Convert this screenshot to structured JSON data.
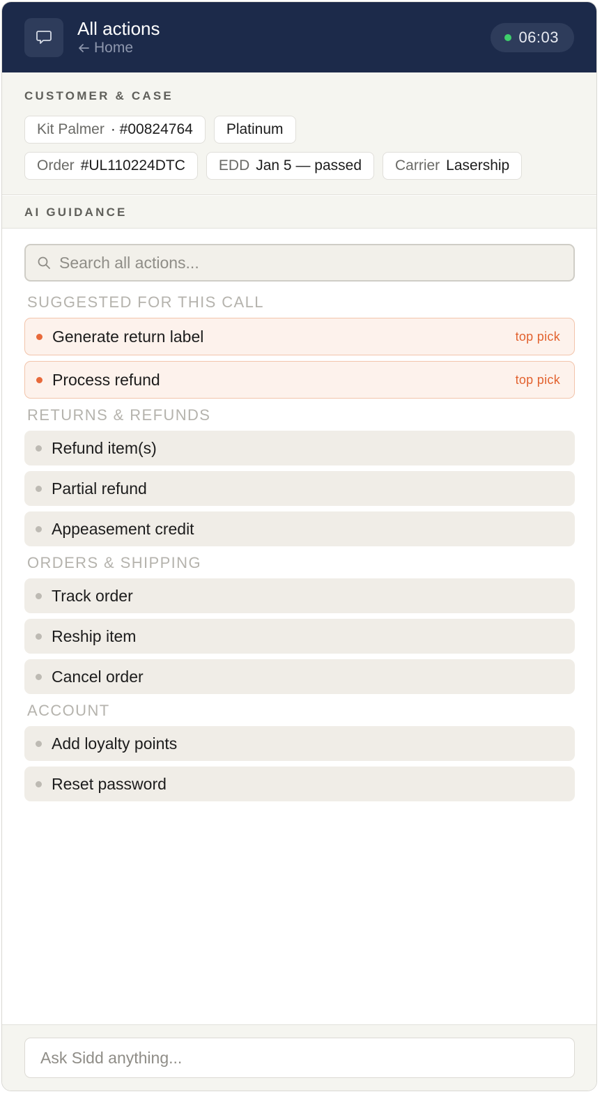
{
  "header": {
    "title": "All actions",
    "back_label": "Home",
    "timer": "06:03",
    "timer_status_color": "#3ecf6b",
    "icon": "chat-bubble-icon"
  },
  "case": {
    "section_label": "CUSTOMER & CASE",
    "customer_name": "Kit Palmer",
    "customer_id": "· #00824764",
    "tier": "Platinum",
    "order_label": "Order",
    "order_value": "#UL110224DTC",
    "edd_label": "EDD",
    "edd_value": "Jan 5 — passed",
    "carrier_label": "Carrier",
    "carrier_value": "Lasership"
  },
  "guidance": {
    "section_label": "AI GUIDANCE"
  },
  "search": {
    "placeholder": "Search all actions..."
  },
  "groups": {
    "suggested": {
      "title": "SUGGESTED FOR THIS CALL",
      "items": [
        {
          "label": "Generate return label",
          "badge": "top pick"
        },
        {
          "label": "Process refund",
          "badge": "top pick"
        }
      ]
    },
    "returns": {
      "title": "RETURNS & REFUNDS",
      "items": [
        {
          "label": "Refund item(s)"
        },
        {
          "label": "Partial refund"
        },
        {
          "label": "Appeasement credit"
        }
      ]
    },
    "orders": {
      "title": "ORDERS & SHIPPING",
      "items": [
        {
          "label": "Track order"
        },
        {
          "label": "Reship item"
        },
        {
          "label": "Cancel order"
        }
      ]
    },
    "account": {
      "title": "ACCOUNT",
      "items": [
        {
          "label": "Add loyalty points"
        },
        {
          "label": "Reset password"
        }
      ]
    }
  },
  "footer": {
    "ask_placeholder": "Ask Sidd anything..."
  },
  "colors": {
    "header_bg": "#1c2a4a",
    "accent": "#e2622f"
  }
}
